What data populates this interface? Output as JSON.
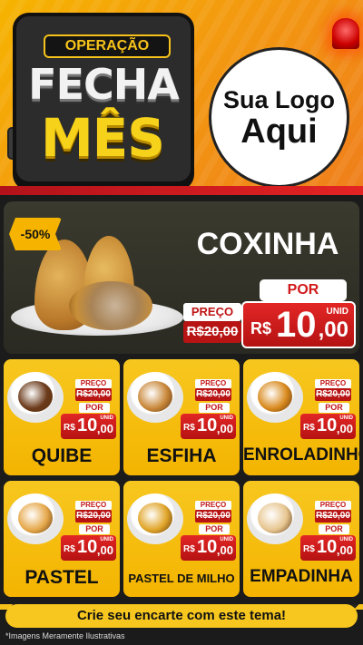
{
  "header": {
    "badge_top": "OPERAÇÃO",
    "badge_line1": "FECHA",
    "badge_line2": "MÊS",
    "logo_line1": "Sua Logo",
    "logo_line2": "Aqui"
  },
  "feature": {
    "discount": "-50%",
    "title": "COXINHA",
    "preco_label": "PREÇO",
    "old_price": "R$20,00",
    "por_label": "POR",
    "currency": "R$",
    "price_int": "10",
    "price_dec": ",00",
    "unit": "UNID"
  },
  "products": [
    {
      "name": "QUIBE",
      "preco_label": "PREÇO",
      "old_price": "R$20,00",
      "por_label": "POR",
      "currency": "R$",
      "price_int": "10",
      "price_dec": ",00",
      "unit": "UNID",
      "food_color": "#6b3a1a"
    },
    {
      "name": "ESFIHA",
      "preco_label": "PREÇO",
      "old_price": "R$20,00",
      "por_label": "POR",
      "currency": "R$",
      "price_int": "10",
      "price_dec": ",00",
      "unit": "UNID",
      "food_color": "#c9883a"
    },
    {
      "name": "ENROLADINHO",
      "preco_label": "PREÇO",
      "old_price": "R$20,00",
      "por_label": "POR",
      "currency": "R$",
      "price_int": "10",
      "price_dec": ",00",
      "unit": "UNID",
      "food_color": "#d98a1e"
    },
    {
      "name": "PASTEL",
      "preco_label": "PREÇO",
      "old_price": "R$20,00",
      "por_label": "POR",
      "currency": "R$",
      "price_int": "10",
      "price_dec": ",00",
      "unit": "UNID",
      "food_color": "#e6a84a"
    },
    {
      "name": "PASTEL DE MILHO",
      "preco_label": "PREÇO",
      "old_price": "R$20,00",
      "por_label": "POR",
      "currency": "R$",
      "price_int": "10",
      "price_dec": ",00",
      "unit": "UNID",
      "food_color": "#e0a528"
    },
    {
      "name": "EMPADINHA",
      "preco_label": "PREÇO",
      "old_price": "R$20,00",
      "por_label": "POR",
      "currency": "R$",
      "price_int": "10",
      "price_dec": ",00",
      "unit": "UNID",
      "food_color": "#e7c690"
    }
  ],
  "footer": {
    "cta": "Crie seu encarte com este tema!",
    "disclaimer": "*Imagens Meramente Ilustrativas"
  },
  "colors": {
    "accent_yellow": "#f7c71f",
    "price_red": "#d11a1a",
    "dark_bg": "#1b1b1b"
  }
}
